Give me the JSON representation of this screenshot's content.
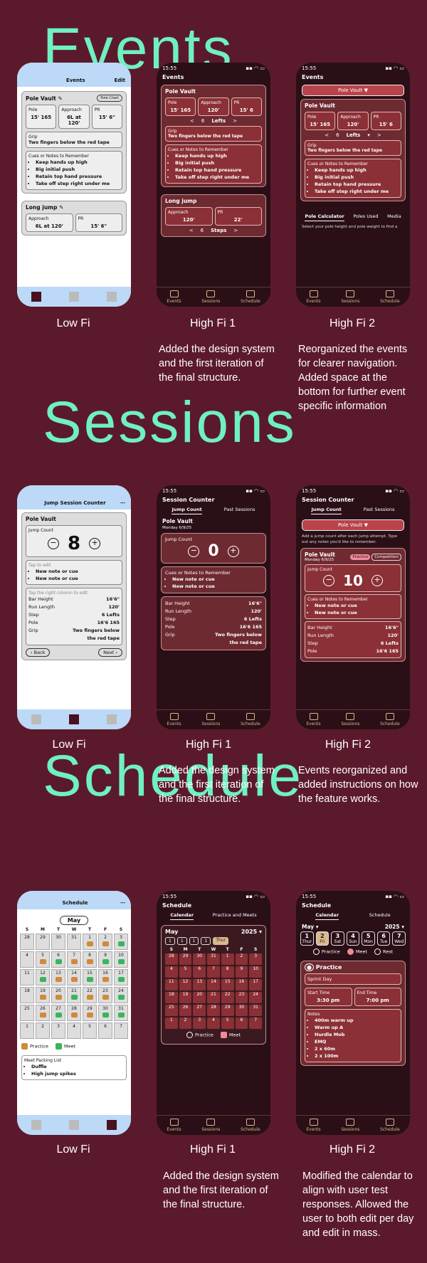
{
  "sections": [
    {
      "heading": "Events"
    },
    {
      "heading": "Sessions"
    },
    {
      "heading": "Schedule"
    }
  ],
  "labels": {
    "low": "Low Fi",
    "high1": "High Fi 1",
    "high2": "High Fi 2"
  },
  "notes": {
    "events_hi1": "Added the design system and the first iteration of the final structure.",
    "events_hi2": "Reorganized the events for clearer navigation. Added space at the bottom for further event specific information",
    "sessions_hi1": "Added the design system and the first iteration of the final structure.",
    "sessions_hi2": "Events reorganized and added instructions on how the feature works.",
    "schedule_hi1": "Added the design system and the first iteration of the final structure.",
    "schedule_hi2": "Modified the calendar to align with user test responses. Allowed the user to both edit per day and edit in mass."
  },
  "phone": {
    "time": "15:55",
    "status": "▪▪ ◠ ▭",
    "nav": [
      "Events",
      "Sessions",
      "Schedule"
    ]
  },
  "events": {
    "title": "Events",
    "edit": "Edit",
    "pole_vault": "Pole Vault",
    "pole_chart": "Pole Chart",
    "stats": [
      {
        "label": "Pole",
        "value": "15' 165"
      },
      {
        "label": "Approach",
        "value": "6L at 120'"
      },
      {
        "label": "PR",
        "value": "15' 6\""
      }
    ],
    "hi_stats": [
      {
        "label": "Pole",
        "value": "15' 165"
      },
      {
        "label": "Approach",
        "value": "120'"
      },
      {
        "label": "PR",
        "value": "15' 6"
      }
    ],
    "grip_label": "Grip",
    "grip": "Two fingers below the red tape",
    "cues_label": "Cues or Notes to Remember",
    "cues": [
      "Keep hands up high",
      "Big initial push",
      "Retain top hand pressure",
      "Take off step right under me"
    ],
    "lefts": "6",
    "lefts_label": "Lefts",
    "long_jump": "Long jump",
    "lj_lo": [
      {
        "label": "Approach",
        "value": "6L at 120'"
      },
      {
        "label": "PR",
        "value": "15' 6\""
      }
    ],
    "lj_hi": [
      {
        "label": "Approach",
        "value": "120'"
      },
      {
        "label": "PR",
        "value": "22'"
      }
    ],
    "steps": "6",
    "steps_label": "Steps",
    "dropdown": "Pole Vault  ▼",
    "hi2_tabs": [
      "Pole Calculator",
      "Poles Used",
      "Media"
    ],
    "calc_text": "Select your pole height and pole weight to find a"
  },
  "sessions": {
    "lo_title": "Jump Session Counter",
    "title": "Session Counter",
    "tabs": [
      "Jump Count",
      "Past Sessions"
    ],
    "event": "Pole Vault",
    "date": "Monday 6/9/25",
    "jump_count": "Jump Count",
    "count_lo": "8",
    "count_hi1": "0",
    "count_hi2": "10",
    "tap_edit": "Tap to edit",
    "notes_lo": [
      "New note or cue",
      "New note or cue"
    ],
    "cues_label": "Cues or Notes to Remember",
    "tap_right": "Tap the right column to edit",
    "table": [
      {
        "k": "Bar Height",
        "v": "16'6\""
      },
      {
        "k": "Run Length",
        "v": "120'"
      },
      {
        "k": "Step",
        "v": "6 Lefts"
      },
      {
        "k": "Pole",
        "v": "16'6 165"
      },
      {
        "k": "Grip",
        "v": "Two fingers below the red tape"
      }
    ],
    "back": "Back",
    "next": "Next",
    "dropdown": "Pole Vault  ▼",
    "instructions": "Add a jump count after each jump attempt. Type out any notes you'd like to remember.",
    "practice": "Practice",
    "competition": "Competition"
  },
  "schedule": {
    "title": "Schedule",
    "lo_month": "May",
    "month": "May",
    "year": "2025",
    "tabs1": [
      "Calendar",
      "Practice and Meets"
    ],
    "tabs2": [
      "Calendar",
      "Schedule"
    ],
    "dow": [
      "S",
      "M",
      "T",
      "W",
      "T",
      "F",
      "S"
    ],
    "days": [
      "28",
      "29",
      "30",
      "31",
      "1",
      "2",
      "3",
      "4",
      "5",
      "6",
      "7",
      "8",
      "9",
      "10",
      "11",
      "12",
      "13",
      "14",
      "15",
      "16",
      "17",
      "18",
      "19",
      "20",
      "21",
      "22",
      "23",
      "24",
      "25",
      "26",
      "27",
      "28",
      "29",
      "30",
      "31",
      "1",
      "2",
      "3",
      "4",
      "5",
      "6",
      "7"
    ],
    "legend": [
      "Practice",
      "Meet"
    ],
    "legend2": [
      "Practice",
      "Meet",
      "Rest"
    ],
    "packing": "Meet Packing List",
    "pack_items": [
      "Duffle",
      "High jump spikes"
    ],
    "week": [
      {
        "n": "1",
        "d": "Thur"
      },
      {
        "n": "2",
        "d": "Fri"
      },
      {
        "n": "3",
        "d": "Sat"
      },
      {
        "n": "4",
        "d": "Sun"
      },
      {
        "n": "5",
        "d": "Mon"
      },
      {
        "n": "6",
        "d": "Tue"
      },
      {
        "n": "7",
        "d": "Wed"
      }
    ],
    "strip1": [
      "1",
      "1",
      "1",
      "1"
    ],
    "strip1_sel": "Thur",
    "practice": "Practice",
    "sprint": "Sprint Day",
    "start_label": "Start Time",
    "start": "3:30 pm",
    "end_label": "End Time",
    "end": "7:00 pm",
    "notes_label": "Notes",
    "notes": [
      "400m warm up",
      "Warm up A",
      "Hurdle Mob",
      "EMQ",
      "2 x 60m",
      "2 x 100m"
    ]
  },
  "colors": {
    "bg": "#5b1a2b",
    "accent": "#6ff0c3",
    "card": "#6e2a31",
    "pink": "#f08a9a"
  }
}
